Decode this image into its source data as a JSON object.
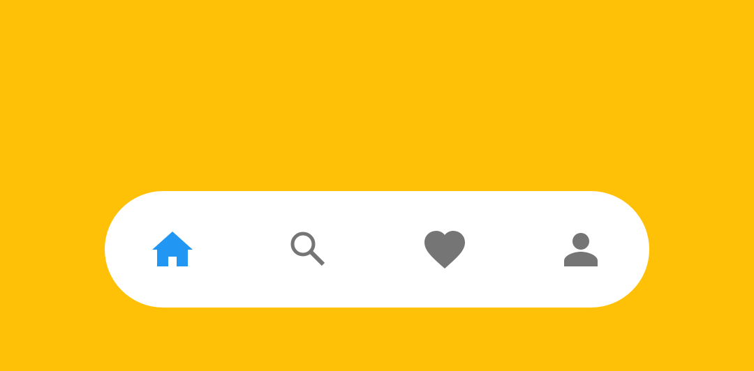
{
  "colors": {
    "background": "#FFC107",
    "nav_bar": "#FFFFFF",
    "active_icon": "#2196F3",
    "inactive_icon": "#757575"
  },
  "bottom_nav": {
    "selected": "home",
    "items": [
      {
        "id": "home",
        "icon": "home-icon",
        "active": true
      },
      {
        "id": "search",
        "icon": "search-icon",
        "active": false
      },
      {
        "id": "favorites",
        "icon": "heart-icon",
        "active": false
      },
      {
        "id": "profile",
        "icon": "person-icon",
        "active": false
      }
    ]
  }
}
